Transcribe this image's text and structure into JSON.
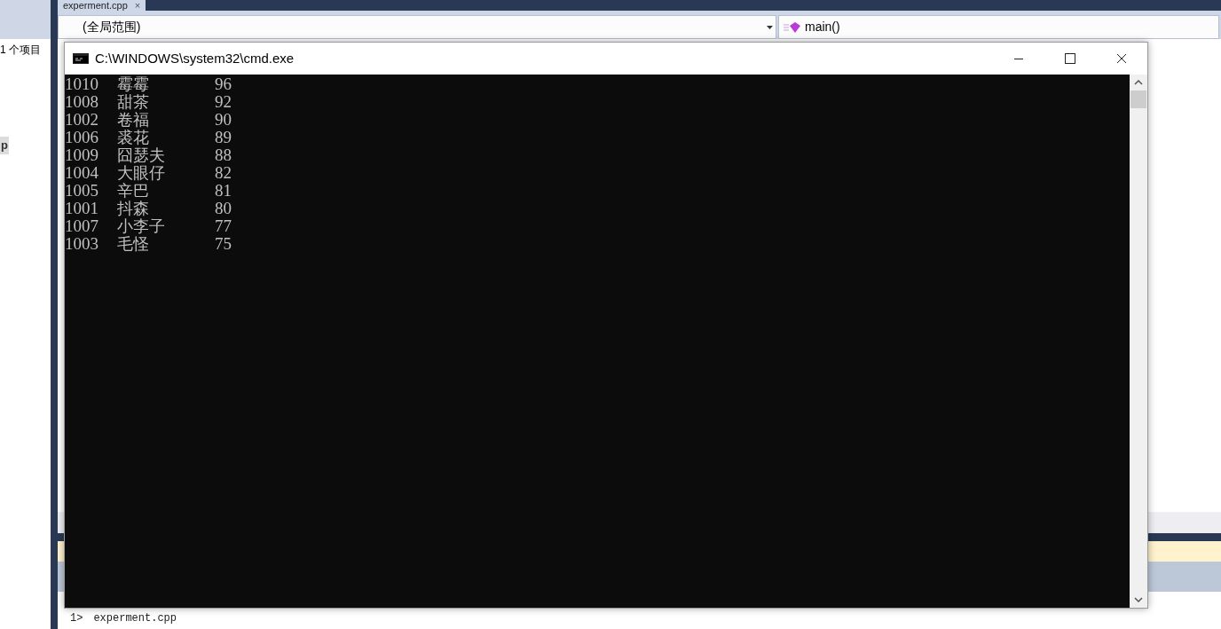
{
  "editor_tab": {
    "label": "experment.cpp",
    "close": "×"
  },
  "solution_explorer": {
    "summary": "1 个项目",
    "selected_item": "p"
  },
  "scope_dropdown": {
    "value": "(全局范围)"
  },
  "function_dropdown": {
    "value": "main()"
  },
  "console_window": {
    "title": "C:\\WINDOWS\\system32\\cmd.exe",
    "rows": [
      {
        "id": "1010",
        "name": "霉霉",
        "score": "96"
      },
      {
        "id": "1008",
        "name": "甜茶",
        "score": "92"
      },
      {
        "id": "1002",
        "name": "卷福",
        "score": "90"
      },
      {
        "id": "1006",
        "name": "裘花",
        "score": "89"
      },
      {
        "id": "1009",
        "name": "囧瑟夫",
        "score": "88"
      },
      {
        "id": "1004",
        "name": "大眼仔",
        "score": "82"
      },
      {
        "id": "1005",
        "name": "辛巴",
        "score": "81"
      },
      {
        "id": "1001",
        "name": "抖森",
        "score": "80"
      },
      {
        "id": "1007",
        "name": "小李子",
        "score": "77"
      },
      {
        "id": "1003",
        "name": "毛怪",
        "score": "75"
      }
    ]
  },
  "output": {
    "prefix": "1>",
    "text": "experment.cpp"
  }
}
